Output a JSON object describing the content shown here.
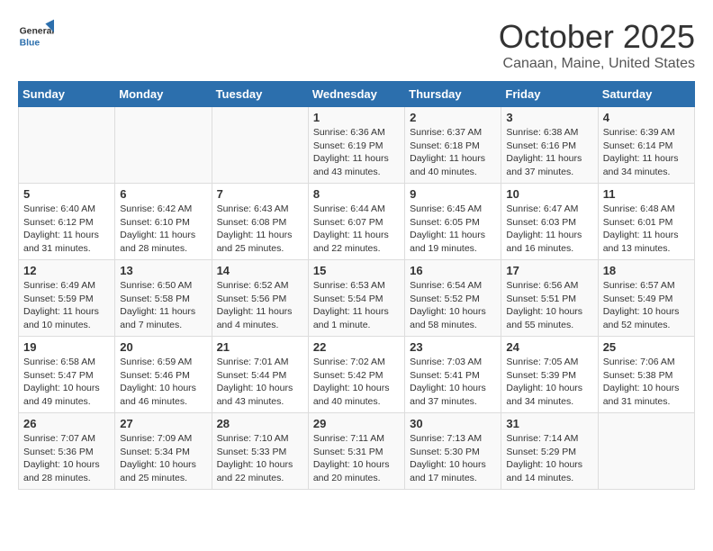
{
  "logo": {
    "general": "General",
    "blue": "Blue"
  },
  "title": "October 2025",
  "location": "Canaan, Maine, United States",
  "weekdays": [
    "Sunday",
    "Monday",
    "Tuesday",
    "Wednesday",
    "Thursday",
    "Friday",
    "Saturday"
  ],
  "weeks": [
    [
      {
        "day": "",
        "sunrise": "",
        "sunset": "",
        "daylight": ""
      },
      {
        "day": "",
        "sunrise": "",
        "sunset": "",
        "daylight": ""
      },
      {
        "day": "",
        "sunrise": "",
        "sunset": "",
        "daylight": ""
      },
      {
        "day": "1",
        "sunrise": "Sunrise: 6:36 AM",
        "sunset": "Sunset: 6:19 PM",
        "daylight": "Daylight: 11 hours and 43 minutes."
      },
      {
        "day": "2",
        "sunrise": "Sunrise: 6:37 AM",
        "sunset": "Sunset: 6:18 PM",
        "daylight": "Daylight: 11 hours and 40 minutes."
      },
      {
        "day": "3",
        "sunrise": "Sunrise: 6:38 AM",
        "sunset": "Sunset: 6:16 PM",
        "daylight": "Daylight: 11 hours and 37 minutes."
      },
      {
        "day": "4",
        "sunrise": "Sunrise: 6:39 AM",
        "sunset": "Sunset: 6:14 PM",
        "daylight": "Daylight: 11 hours and 34 minutes."
      }
    ],
    [
      {
        "day": "5",
        "sunrise": "Sunrise: 6:40 AM",
        "sunset": "Sunset: 6:12 PM",
        "daylight": "Daylight: 11 hours and 31 minutes."
      },
      {
        "day": "6",
        "sunrise": "Sunrise: 6:42 AM",
        "sunset": "Sunset: 6:10 PM",
        "daylight": "Daylight: 11 hours and 28 minutes."
      },
      {
        "day": "7",
        "sunrise": "Sunrise: 6:43 AM",
        "sunset": "Sunset: 6:08 PM",
        "daylight": "Daylight: 11 hours and 25 minutes."
      },
      {
        "day": "8",
        "sunrise": "Sunrise: 6:44 AM",
        "sunset": "Sunset: 6:07 PM",
        "daylight": "Daylight: 11 hours and 22 minutes."
      },
      {
        "day": "9",
        "sunrise": "Sunrise: 6:45 AM",
        "sunset": "Sunset: 6:05 PM",
        "daylight": "Daylight: 11 hours and 19 minutes."
      },
      {
        "day": "10",
        "sunrise": "Sunrise: 6:47 AM",
        "sunset": "Sunset: 6:03 PM",
        "daylight": "Daylight: 11 hours and 16 minutes."
      },
      {
        "day": "11",
        "sunrise": "Sunrise: 6:48 AM",
        "sunset": "Sunset: 6:01 PM",
        "daylight": "Daylight: 11 hours and 13 minutes."
      }
    ],
    [
      {
        "day": "12",
        "sunrise": "Sunrise: 6:49 AM",
        "sunset": "Sunset: 5:59 PM",
        "daylight": "Daylight: 11 hours and 10 minutes."
      },
      {
        "day": "13",
        "sunrise": "Sunrise: 6:50 AM",
        "sunset": "Sunset: 5:58 PM",
        "daylight": "Daylight: 11 hours and 7 minutes."
      },
      {
        "day": "14",
        "sunrise": "Sunrise: 6:52 AM",
        "sunset": "Sunset: 5:56 PM",
        "daylight": "Daylight: 11 hours and 4 minutes."
      },
      {
        "day": "15",
        "sunrise": "Sunrise: 6:53 AM",
        "sunset": "Sunset: 5:54 PM",
        "daylight": "Daylight: 11 hours and 1 minute."
      },
      {
        "day": "16",
        "sunrise": "Sunrise: 6:54 AM",
        "sunset": "Sunset: 5:52 PM",
        "daylight": "Daylight: 10 hours and 58 minutes."
      },
      {
        "day": "17",
        "sunrise": "Sunrise: 6:56 AM",
        "sunset": "Sunset: 5:51 PM",
        "daylight": "Daylight: 10 hours and 55 minutes."
      },
      {
        "day": "18",
        "sunrise": "Sunrise: 6:57 AM",
        "sunset": "Sunset: 5:49 PM",
        "daylight": "Daylight: 10 hours and 52 minutes."
      }
    ],
    [
      {
        "day": "19",
        "sunrise": "Sunrise: 6:58 AM",
        "sunset": "Sunset: 5:47 PM",
        "daylight": "Daylight: 10 hours and 49 minutes."
      },
      {
        "day": "20",
        "sunrise": "Sunrise: 6:59 AM",
        "sunset": "Sunset: 5:46 PM",
        "daylight": "Daylight: 10 hours and 46 minutes."
      },
      {
        "day": "21",
        "sunrise": "Sunrise: 7:01 AM",
        "sunset": "Sunset: 5:44 PM",
        "daylight": "Daylight: 10 hours and 43 minutes."
      },
      {
        "day": "22",
        "sunrise": "Sunrise: 7:02 AM",
        "sunset": "Sunset: 5:42 PM",
        "daylight": "Daylight: 10 hours and 40 minutes."
      },
      {
        "day": "23",
        "sunrise": "Sunrise: 7:03 AM",
        "sunset": "Sunset: 5:41 PM",
        "daylight": "Daylight: 10 hours and 37 minutes."
      },
      {
        "day": "24",
        "sunrise": "Sunrise: 7:05 AM",
        "sunset": "Sunset: 5:39 PM",
        "daylight": "Daylight: 10 hours and 34 minutes."
      },
      {
        "day": "25",
        "sunrise": "Sunrise: 7:06 AM",
        "sunset": "Sunset: 5:38 PM",
        "daylight": "Daylight: 10 hours and 31 minutes."
      }
    ],
    [
      {
        "day": "26",
        "sunrise": "Sunrise: 7:07 AM",
        "sunset": "Sunset: 5:36 PM",
        "daylight": "Daylight: 10 hours and 28 minutes."
      },
      {
        "day": "27",
        "sunrise": "Sunrise: 7:09 AM",
        "sunset": "Sunset: 5:34 PM",
        "daylight": "Daylight: 10 hours and 25 minutes."
      },
      {
        "day": "28",
        "sunrise": "Sunrise: 7:10 AM",
        "sunset": "Sunset: 5:33 PM",
        "daylight": "Daylight: 10 hours and 22 minutes."
      },
      {
        "day": "29",
        "sunrise": "Sunrise: 7:11 AM",
        "sunset": "Sunset: 5:31 PM",
        "daylight": "Daylight: 10 hours and 20 minutes."
      },
      {
        "day": "30",
        "sunrise": "Sunrise: 7:13 AM",
        "sunset": "Sunset: 5:30 PM",
        "daylight": "Daylight: 10 hours and 17 minutes."
      },
      {
        "day": "31",
        "sunrise": "Sunrise: 7:14 AM",
        "sunset": "Sunset: 5:29 PM",
        "daylight": "Daylight: 10 hours and 14 minutes."
      },
      {
        "day": "",
        "sunrise": "",
        "sunset": "",
        "daylight": ""
      }
    ]
  ]
}
